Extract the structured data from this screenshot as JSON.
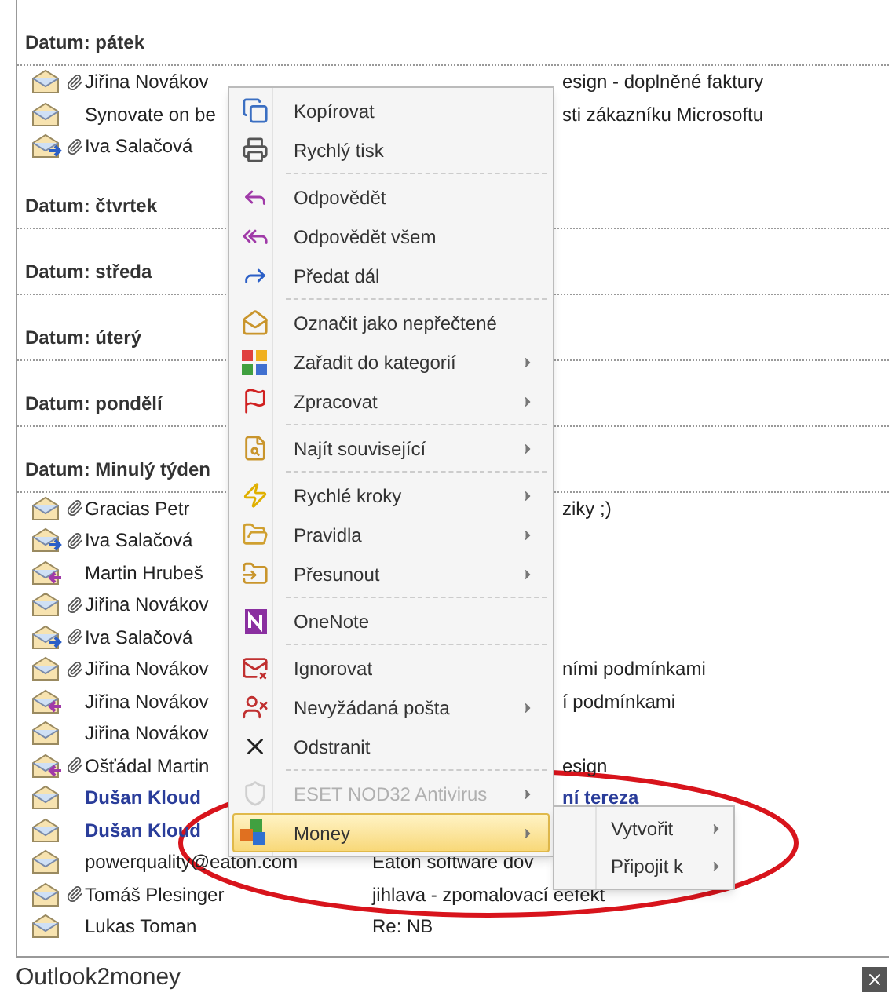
{
  "groups": [
    {
      "heading": "Datum: pátek",
      "rows": [
        {
          "kind": "read",
          "attachment": true,
          "unread": false,
          "sender": "Jiřina Novákov",
          "subject": "esign - doplněné faktury"
        },
        {
          "kind": "read",
          "attachment": false,
          "unread": false,
          "sender": "Synovate on be",
          "subject": "sti zákazníku Microsoftu"
        },
        {
          "kind": "forwarded",
          "attachment": true,
          "unread": false,
          "sender": "Iva Salačová"
        }
      ]
    },
    {
      "heading": "Datum: čtvrtek"
    },
    {
      "heading": "Datum: středa"
    },
    {
      "heading": "Datum: úterý"
    },
    {
      "heading": "Datum: pondělí"
    },
    {
      "heading": "Datum: Minulý týden",
      "rows": [
        {
          "kind": "read",
          "attachment": true,
          "unread": false,
          "sender": "Gracias Petr",
          "subject": "ziky ;)"
        },
        {
          "kind": "forwarded",
          "attachment": true,
          "unread": false,
          "sender": "Iva Salačová"
        },
        {
          "kind": "replied",
          "attachment": false,
          "unread": false,
          "sender": "Martin Hrubeš"
        },
        {
          "kind": "read",
          "attachment": true,
          "unread": false,
          "sender": "Jiřina Novákov"
        },
        {
          "kind": "forwarded",
          "attachment": true,
          "unread": false,
          "sender": "Iva Salačová"
        },
        {
          "kind": "read",
          "attachment": true,
          "unread": false,
          "sender": "Jiřina Novákov",
          "subject": "ními podmínkami"
        },
        {
          "kind": "replied",
          "attachment": false,
          "unread": false,
          "sender": "Jiřina Novákov",
          "subject": "í podmínkami"
        },
        {
          "kind": "read",
          "attachment": false,
          "unread": false,
          "sender": "Jiřina Novákov"
        },
        {
          "kind": "replied",
          "attachment": true,
          "unread": false,
          "sender": "Ošťádal Martin",
          "subject": "esign"
        },
        {
          "kind": "read",
          "attachment": false,
          "unread": true,
          "sender": "Dušan Kloud",
          "subject": "ní tereza"
        },
        {
          "kind": "read",
          "attachment": false,
          "unread": true,
          "sender": "Dušan Kloud"
        },
        {
          "kind": "read",
          "attachment": false,
          "unread": false,
          "sender": "powerquality@eaton.com",
          "subject": "Eaton software dov"
        },
        {
          "kind": "read",
          "attachment": true,
          "unread": false,
          "sender": "Tomáš Plesinger",
          "subject": "jihlava - zpomalovací eefekt"
        },
        {
          "kind": "read",
          "attachment": false,
          "unread": false,
          "sender": "Lukas Toman",
          "subject": "Re: NB"
        }
      ]
    }
  ],
  "context_menu": {
    "items": [
      {
        "kind": "item",
        "label": "Kopírovat",
        "submenu": false,
        "disabled": false,
        "selected": false
      },
      {
        "kind": "item",
        "label": "Rychlý tisk",
        "submenu": false,
        "disabled": false,
        "selected": false
      },
      {
        "kind": "separator"
      },
      {
        "kind": "item",
        "label": "Odpovědět",
        "submenu": false,
        "disabled": false,
        "selected": false
      },
      {
        "kind": "item",
        "label": "Odpovědět všem",
        "submenu": false,
        "disabled": false,
        "selected": false
      },
      {
        "kind": "item",
        "label": "Předat dál",
        "submenu": false,
        "disabled": false,
        "selected": false
      },
      {
        "kind": "separator"
      },
      {
        "kind": "item",
        "label": "Označit jako nepřečtené",
        "submenu": false,
        "disabled": false,
        "selected": false
      },
      {
        "kind": "item",
        "label": "Zařadit do kategorií",
        "submenu": true,
        "disabled": false,
        "selected": false
      },
      {
        "kind": "item",
        "label": "Zpracovat",
        "submenu": true,
        "disabled": false,
        "selected": false
      },
      {
        "kind": "separator"
      },
      {
        "kind": "item",
        "label": "Najít související",
        "submenu": true,
        "disabled": false,
        "selected": false
      },
      {
        "kind": "separator"
      },
      {
        "kind": "item",
        "label": "Rychlé kroky",
        "submenu": true,
        "disabled": false,
        "selected": false
      },
      {
        "kind": "item",
        "label": "Pravidla",
        "submenu": true,
        "disabled": false,
        "selected": false
      },
      {
        "kind": "item",
        "label": "Přesunout",
        "submenu": true,
        "disabled": false,
        "selected": false
      },
      {
        "kind": "separator"
      },
      {
        "kind": "item",
        "label": "OneNote",
        "submenu": false,
        "disabled": false,
        "selected": false
      },
      {
        "kind": "separator"
      },
      {
        "kind": "item",
        "label": "Ignorovat",
        "submenu": false,
        "disabled": false,
        "selected": false
      },
      {
        "kind": "item",
        "label": "Nevyžádaná pošta",
        "submenu": true,
        "disabled": false,
        "selected": false
      },
      {
        "kind": "item",
        "label": "Odstranit",
        "submenu": false,
        "disabled": false,
        "selected": false
      },
      {
        "kind": "separator"
      },
      {
        "kind": "item",
        "label": "ESET NOD32 Antivirus",
        "submenu": true,
        "disabled": true,
        "selected": false
      },
      {
        "kind": "item",
        "label": "Money",
        "submenu": true,
        "disabled": false,
        "selected": true
      }
    ]
  },
  "submenu": {
    "items": [
      {
        "label": "Vytvořit",
        "submenu": true
      },
      {
        "label": "Připojit k",
        "submenu": true
      }
    ]
  },
  "status_bar": {
    "title": "Outlook2money"
  }
}
